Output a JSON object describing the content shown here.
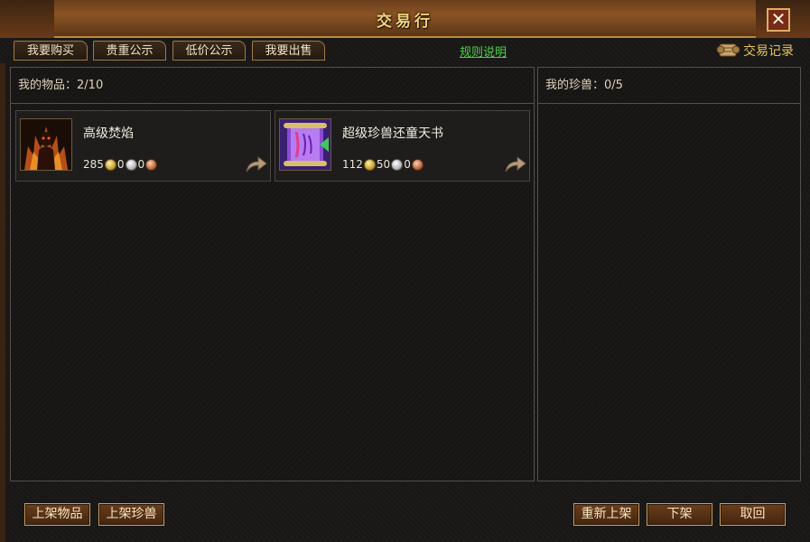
{
  "window": {
    "title": "交易行",
    "close_label": "✕"
  },
  "tabs": [
    {
      "label": "我要购买"
    },
    {
      "label": "贵重公示"
    },
    {
      "label": "低价公示"
    },
    {
      "label": "我要出售"
    }
  ],
  "rules_link": "规则说明",
  "records_label": "交易记录",
  "items_panel": {
    "header_label": "我的物品：",
    "count": "2/10",
    "items": [
      {
        "name": "高级焚焰",
        "gold": "285",
        "silver": "0",
        "copper": "0",
        "icon": "flame-demon-icon"
      },
      {
        "name": "超级珍兽还童天书",
        "gold": "112",
        "silver": "50",
        "copper": "0",
        "icon": "purple-scroll-icon"
      }
    ]
  },
  "pets_panel": {
    "header_label": "我的珍兽：",
    "count": "0/5"
  },
  "buttons": {
    "list_item": "上架物品",
    "list_pet": "上架珍兽",
    "relist": "重新上架",
    "delist": "下架",
    "retrieve": "取回"
  },
  "colors": {
    "accent_gold": "#f3d27a",
    "link_green": "#4fcf4a",
    "panel_bg": "#1a1918"
  }
}
